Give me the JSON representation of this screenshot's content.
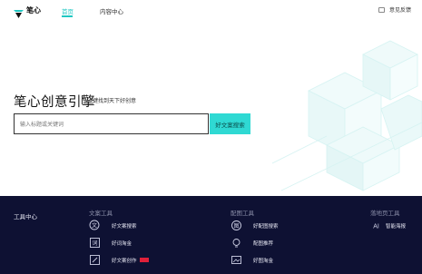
{
  "header": {
    "logo_text": "笔心",
    "nav": [
      {
        "label": "首页",
        "active": true
      },
      {
        "label": "内容中心",
        "active": false
      }
    ],
    "feedback_label": "意见反馈"
  },
  "hero": {
    "title": "笔心创意引擎",
    "subtitle": "一键找到天下好创意",
    "search": {
      "placeholder": "输入标题或关键词",
      "button_label": "好文案搜索"
    }
  },
  "footer": {
    "label": "工具中心",
    "columns": [
      {
        "title": "文案工具",
        "tools": [
          {
            "label": "好文案搜索",
            "icon": "copy-search-icon"
          },
          {
            "label": "好词淘金",
            "icon": "word-gold-icon"
          },
          {
            "label": "好文案创作",
            "icon": "copy-create-icon",
            "badge": true
          }
        ]
      },
      {
        "title": "配图工具",
        "tools": [
          {
            "label": "好配图搜索",
            "icon": "image-search-icon"
          },
          {
            "label": "配图推荐",
            "icon": "image-recommend-icon"
          },
          {
            "label": "好图淘金",
            "icon": "image-gold-icon"
          }
        ]
      },
      {
        "title": "落地页工具",
        "tools": [
          {
            "label": "智能海报",
            "icon": "ai-poster-icon"
          }
        ]
      }
    ]
  },
  "colors": {
    "accent": "#2fd9d3",
    "footer_bg": "#0e1133",
    "badge": "#e0203a"
  }
}
